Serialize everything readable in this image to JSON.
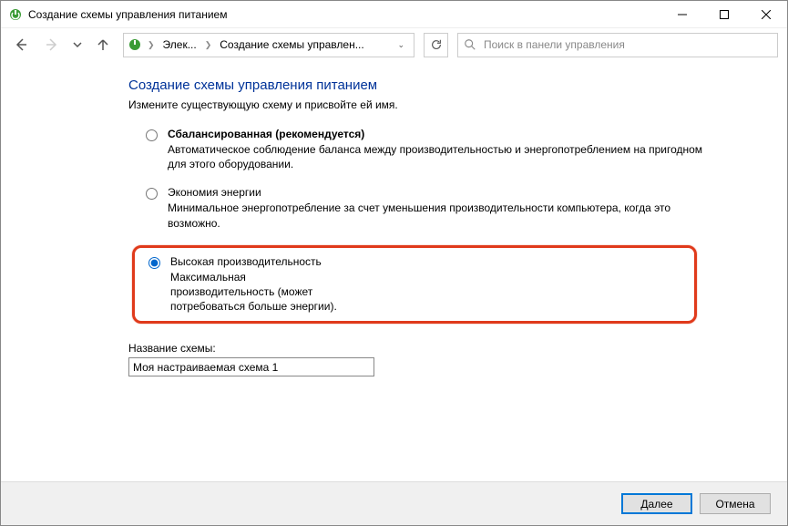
{
  "window": {
    "title": "Создание схемы управления питанием"
  },
  "breadcrumb": {
    "crumb1": "Элек...",
    "crumb2": "Создание схемы управлен..."
  },
  "search": {
    "placeholder": "Поиск в панели управления"
  },
  "page": {
    "heading": "Создание схемы управления питанием",
    "subheading": "Измените существующую схему и присвойте ей имя."
  },
  "plans": {
    "balanced": {
      "title": "Сбалансированная (рекомендуется)",
      "desc": "Автоматическое соблюдение баланса между производительностью и энергопотреблением на пригодном для этого оборудовании."
    },
    "saver": {
      "title": "Экономия энергии",
      "desc": "Минимальное энергопотребление за счет уменьшения производительности компьютера, когда это возможно."
    },
    "high": {
      "title": "Высокая производительность",
      "desc": "Максимальная производительность (может потребоваться больше энергии)."
    }
  },
  "nameSection": {
    "label": "Название схемы:",
    "value": "Моя настраиваемая схема 1"
  },
  "buttons": {
    "next": "Далее",
    "cancel": "Отмена"
  }
}
